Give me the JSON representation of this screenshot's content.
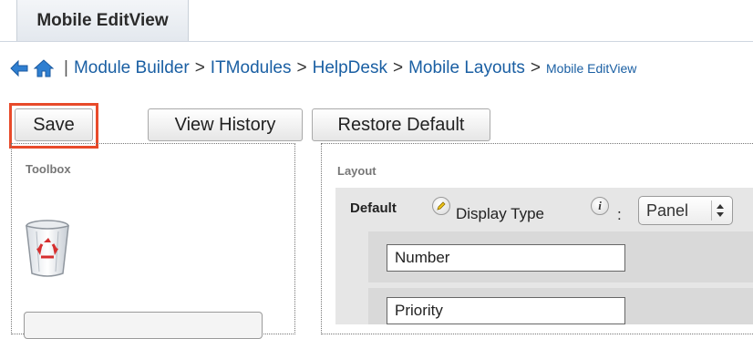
{
  "tab": {
    "label": "Mobile EditView"
  },
  "breadcrumb": {
    "separator": "|",
    "items": [
      "Module Builder",
      "ITModules",
      "HelpDesk",
      "Mobile Layouts"
    ],
    "current": "Mobile EditView",
    "arrow": ">"
  },
  "toolbar": {
    "save_label": "Save",
    "view_history_label": "View History",
    "restore_default_label": "Restore Default"
  },
  "toolbox": {
    "title": "Toolbox"
  },
  "layout": {
    "title": "Layout",
    "panel_name": "Default",
    "display_type_label": "Display Type",
    "colon": ":",
    "display_type_value": "Panel",
    "fields": [
      "Number",
      "Priority"
    ]
  },
  "colors": {
    "highlight": "#e84a2a",
    "link": "#1a5fa3"
  }
}
